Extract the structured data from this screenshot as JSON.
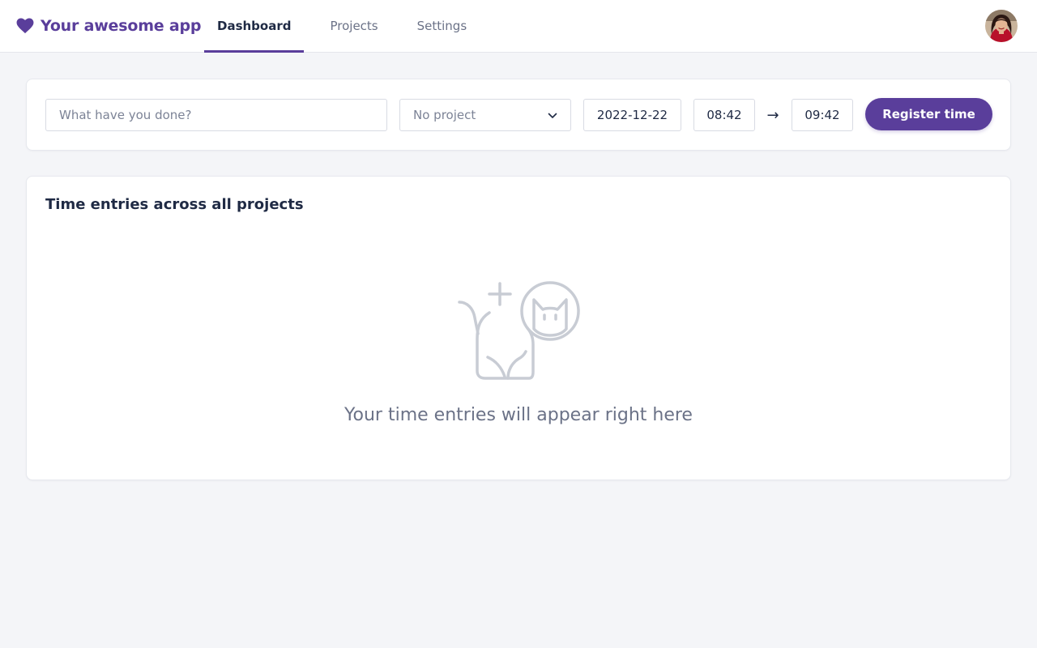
{
  "app": {
    "name": "Your awesome app",
    "brand_icon": "heart-icon",
    "accent_color": "#5a3e9b"
  },
  "nav": {
    "tabs": [
      {
        "label": "Dashboard",
        "active": true
      },
      {
        "label": "Projects",
        "active": false
      },
      {
        "label": "Settings",
        "active": false
      }
    ]
  },
  "user": {
    "avatar": "user-avatar"
  },
  "entry_form": {
    "description_placeholder": "What have you done?",
    "description_value": "",
    "project_selected": "No project",
    "date": "2022-12-22",
    "start_time": "08:42",
    "arrow": "→",
    "end_time": "09:42",
    "submit_label": "Register time"
  },
  "entries": {
    "title": "Time entries across all projects",
    "empty_icon": "cat-add-icon",
    "empty_message": "Your time entries will appear right here"
  }
}
